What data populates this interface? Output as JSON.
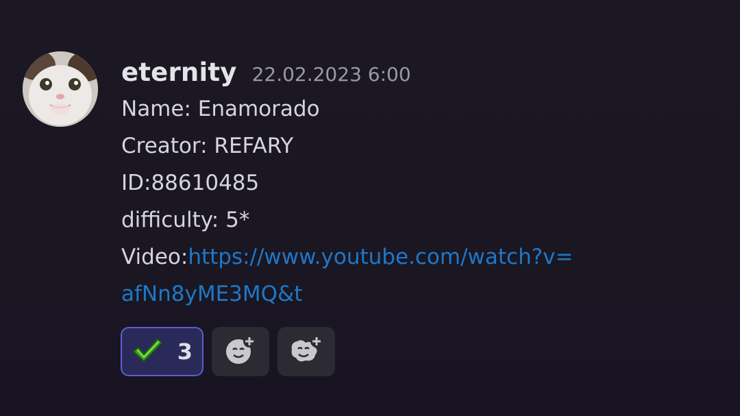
{
  "message": {
    "username": "eternity",
    "timestamp": "22.02.2023 6:00",
    "lines": {
      "name": "Name: Enamorado",
      "creator": "Creator: REFARY",
      "id": "ID:88610485",
      "difficulty": "difficulty: 5*",
      "video_label": "Video:",
      "video_link_part1": "https://www.youtube.com/watch?v=",
      "video_link_part2": "afNn8yME3MQ&t"
    }
  },
  "reactions": [
    {
      "emoji": "check-mark-icon",
      "count": "3",
      "selected": true
    },
    {
      "emoji": "add-reaction-icon"
    },
    {
      "emoji": "add-super-reaction-icon"
    }
  ],
  "colors": {
    "background": "#1a1622",
    "text": "#d6d5db",
    "link": "#1e78c8",
    "reaction_selected_bg": "#2a2a5a",
    "reaction_selected_border": "#5c5ed2"
  }
}
